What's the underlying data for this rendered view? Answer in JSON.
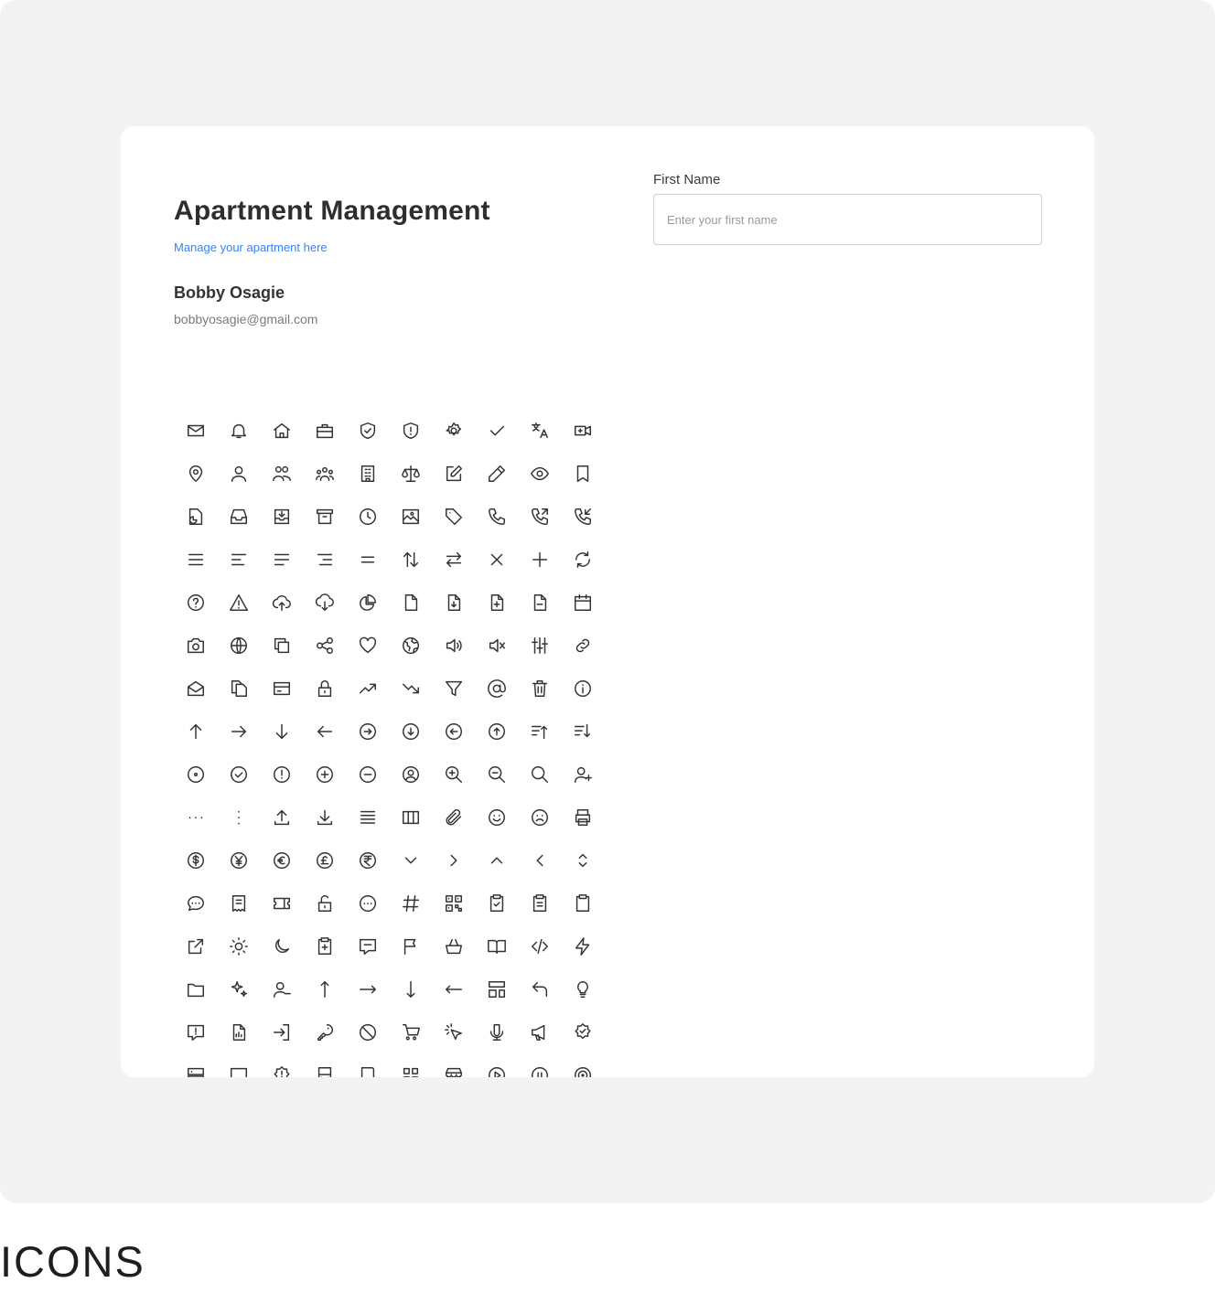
{
  "app": {
    "title": "Apartment Management",
    "subtitle": "Manage your apartment here"
  },
  "user": {
    "name": "Bobby Osagie",
    "email": "bobbyosagie@gmail.com"
  },
  "form": {
    "first_name_label": "First Name",
    "first_name_placeholder": "Enter your first name",
    "first_name_value": ""
  },
  "footer": {
    "label": "ICONS"
  },
  "colors": {
    "accent": "#3b82f6",
    "icon_stroke": "#333333",
    "background": "#f3f3f3",
    "card": "#ffffff"
  },
  "icons": [
    "mail",
    "bell",
    "home",
    "briefcase",
    "shield-check",
    "shield-alert",
    "settings",
    "check",
    "translate",
    "video-call",
    "map-pin",
    "user",
    "users",
    "team",
    "building",
    "scale",
    "edit",
    "pencil",
    "eye",
    "bookmark",
    "pie-doc",
    "inbox",
    "inbox-download",
    "archive",
    "clock",
    "image",
    "tag",
    "phone",
    "phone-outgoing",
    "phone-incoming",
    "menu",
    "align-left",
    "align-center",
    "align-right",
    "equal",
    "sort-vertical",
    "swap-horizontal",
    "close",
    "plus",
    "refresh",
    "help-circle",
    "warning",
    "cloud-upload",
    "cloud-download",
    "pie-chart",
    "file",
    "file-download",
    "file-plus",
    "file-minus",
    "calendar",
    "camera",
    "globe",
    "copy",
    "share",
    "heart",
    "earth",
    "volume",
    "volume-mute",
    "sliders",
    "link",
    "mail-open",
    "files",
    "credit-card",
    "lock",
    "trending-up",
    "trending-down",
    "filter",
    "at-sign",
    "trash",
    "info",
    "arrow-up",
    "arrow-right",
    "arrow-down",
    "arrow-left",
    "circle-arrow-right",
    "circle-arrow-down",
    "circle-arrow-left",
    "circle-arrow-up",
    "sort-up",
    "sort-down",
    "circle-dot",
    "circle-check",
    "circle-alert",
    "circle-plus",
    "circle-minus",
    "circle-user",
    "zoom-in",
    "zoom-out",
    "search",
    "user-plus",
    "more-horizontal",
    "more-vertical",
    "upload",
    "download",
    "list",
    "columns",
    "paperclip",
    "smile",
    "sad",
    "printer",
    "dollar",
    "yen",
    "euro",
    "pound",
    "rupee",
    "chevron-down",
    "chevron-right",
    "chevron-up",
    "chevron-left",
    "chevron-up-down",
    "chat",
    "receipt",
    "ticket",
    "unlock",
    "circle-dots",
    "hash",
    "qr-code",
    "clipboard-check",
    "clipboard-list",
    "clipboard",
    "external-link",
    "sun",
    "moon",
    "clipboard-plus",
    "message-square",
    "flag",
    "basket",
    "book-open",
    "code",
    "zap",
    "folder",
    "sparkles",
    "user-minus",
    "long-arrow-up",
    "long-arrow-right",
    "long-arrow-down",
    "long-arrow-left",
    "layout",
    "undo",
    "lightbulb",
    "message-alert",
    "file-chart",
    "log-in",
    "key",
    "ban",
    "cart",
    "cursor-click",
    "microphone",
    "megaphone",
    "badge-check",
    "server",
    "monitor",
    "badge-alert",
    "bus",
    "book",
    "apps",
    "store",
    "play-circle",
    "pause-circle",
    "target"
  ]
}
